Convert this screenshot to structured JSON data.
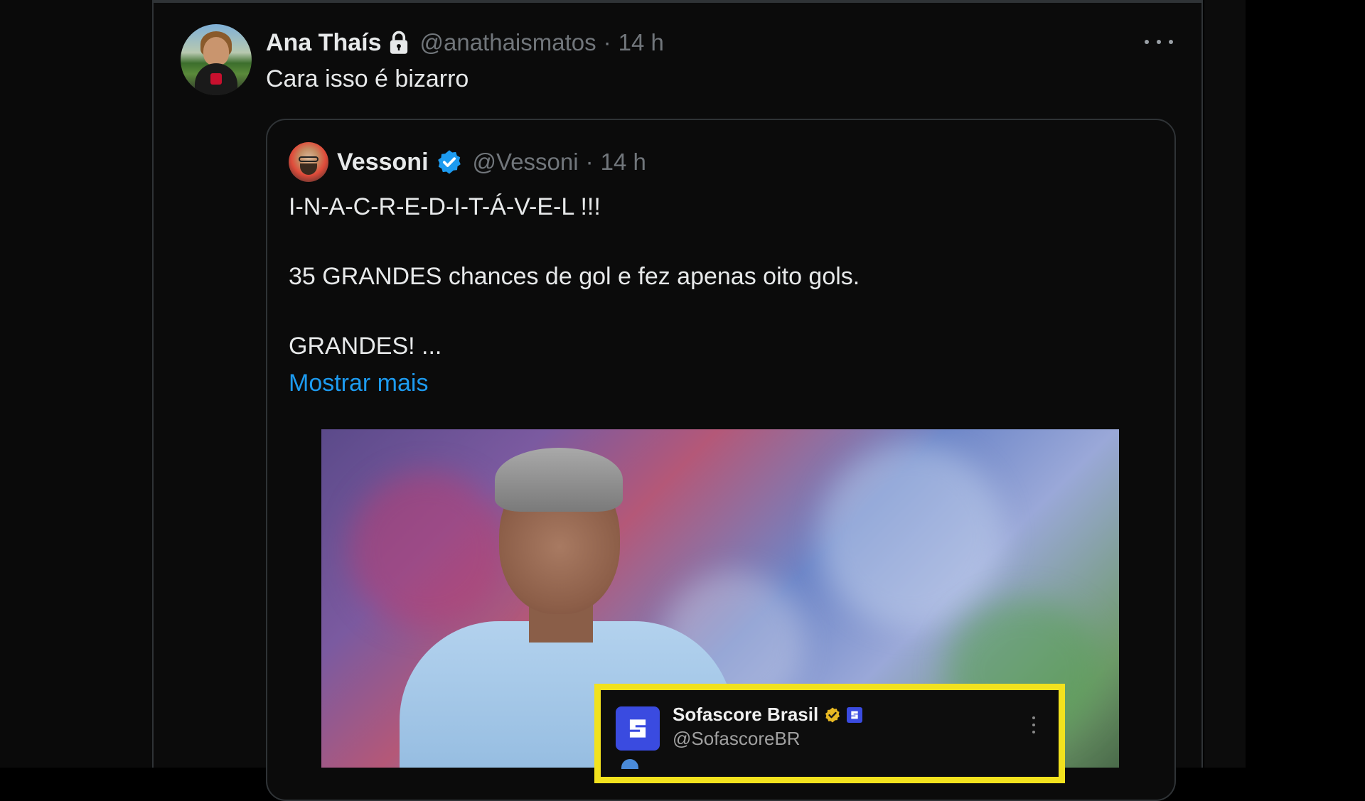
{
  "tweet": {
    "display_name": "Ana Thaís",
    "handle": "@anathaismatos",
    "separator": "·",
    "time": "14 h",
    "text": "Cara isso é bizarro"
  },
  "quoted_tweet": {
    "display_name": "Vessoni",
    "handle": "@Vessoni",
    "separator": "·",
    "time": "14 h",
    "lines": [
      "I-N-A-C-R-E-D-I-T-Á-V-E-L !!!",
      "35 GRANDES chances de gol e fez apenas oito gols.",
      "GRANDES! ..."
    ],
    "show_more": "Mostrar mais"
  },
  "media_overlay": {
    "account_name": "Sofascore Brasil",
    "account_handle": "@SofascoreBR"
  },
  "colors": {
    "background": "#000000",
    "link": "#1d9bf0",
    "verified": "#1d9bf0",
    "overlay_border": "#f2e21e",
    "sofascore_brand": "#3a4be0"
  },
  "icons": [
    "lock-icon",
    "more-icon",
    "verified-icon",
    "gold-verified-icon",
    "sofascore-logo-icon"
  ]
}
